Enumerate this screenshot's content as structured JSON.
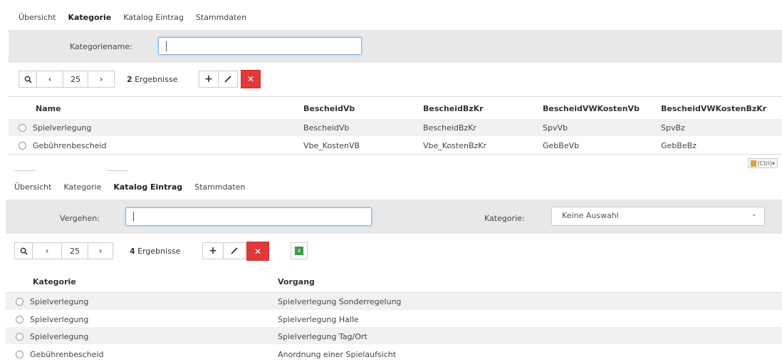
{
  "top": {
    "tabs": [
      "Übersicht",
      "Kategorie",
      "Katalog Eintrag",
      "Stammdaten"
    ],
    "filter_label": "Kategoriename:",
    "filter_value": "",
    "page_size": "25",
    "result_count": "2",
    "result_suffix": "Ergebnisse",
    "columns": [
      "Name",
      "BescheidVb",
      "BescheidBzKr",
      "BescheidVWKostenVb",
      "BescheidVWKostenBzKr"
    ],
    "rows": [
      [
        "Spielverlegung",
        "BescheidVb",
        "BescheidBzKr",
        "SpvVb",
        "SpvBz"
      ],
      [
        "Gebührenbescheid",
        "Vbe_KostenVB",
        "Vbe_KostenBzKr",
        "GebBeVb",
        "GebBeBz"
      ]
    ]
  },
  "clipboard_badge": "(Ctrl)",
  "bottom": {
    "tabs": [
      "Übersicht",
      "Kategorie",
      "Katalog Eintrag",
      "Stammdaten"
    ],
    "filter_label": "Vergehen:",
    "filter_value": "",
    "category_label": "Kategorie:",
    "category_value": "Keine Auswahl",
    "page_size": "25",
    "result_count": "4",
    "result_suffix": "Ergebnisse",
    "columns": [
      "Kategorie",
      "Vorgang"
    ],
    "rows": [
      [
        "Spielverlegung",
        "Spielverlegung Sonderregelung"
      ],
      [
        "Spielverlegung",
        "Spielverlegung Halle"
      ],
      [
        "Spielverlegung",
        "Spielverlegung Tag/Ort"
      ],
      [
        "Gebührenbescheid",
        "Anordnung einer Spielaufsicht"
      ]
    ]
  },
  "icons": {
    "search": "search-icon",
    "prev": "chevron-left-icon",
    "next": "chevron-right-icon",
    "add": "plus-icon",
    "edit": "pencil-icon",
    "delete": "close-icon",
    "export": "excel-icon"
  },
  "colors": {
    "accent_red": "#e0393c",
    "filter_bg": "#e8e8e8",
    "input_focus": "#7fb3e0"
  }
}
